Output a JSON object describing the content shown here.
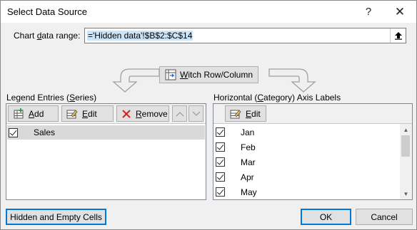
{
  "window": {
    "title": "Select Data Source",
    "help_glyph": "?",
    "close_glyph": "✕"
  },
  "range": {
    "label_pre": "Chart ",
    "label_key": "d",
    "label_post": "ata range:",
    "value": "='Hidden data'!$B$2:$C$14"
  },
  "switch_button": {
    "pre": "",
    "key": "W",
    "post": "Switch Row/Column",
    "full": "Switch Row/Column"
  },
  "legend": {
    "label_pre": "Legend Entries (",
    "label_key": "S",
    "label_post": "eries)",
    "add": {
      "key": "A",
      "rest": "dd"
    },
    "edit": {
      "key": "E",
      "rest": "dit"
    },
    "remove": {
      "key": "R",
      "rest": "emove"
    },
    "items": [
      {
        "label": "Sales",
        "checked": true
      }
    ]
  },
  "axis": {
    "label_pre": "Horizontal (",
    "label_key": "C",
    "label_post": "ategory) Axis Labels",
    "edit": {
      "key": "E",
      "rest": "dit"
    },
    "items": [
      {
        "label": "Jan",
        "checked": true
      },
      {
        "label": "Feb",
        "checked": true
      },
      {
        "label": "Mar",
        "checked": true
      },
      {
        "label": "Apr",
        "checked": true
      },
      {
        "label": "May",
        "checked": true
      }
    ]
  },
  "footer": {
    "hidden_cells": "Hidden and Empty Cells",
    "ok": "OK",
    "cancel": "Cancel"
  }
}
